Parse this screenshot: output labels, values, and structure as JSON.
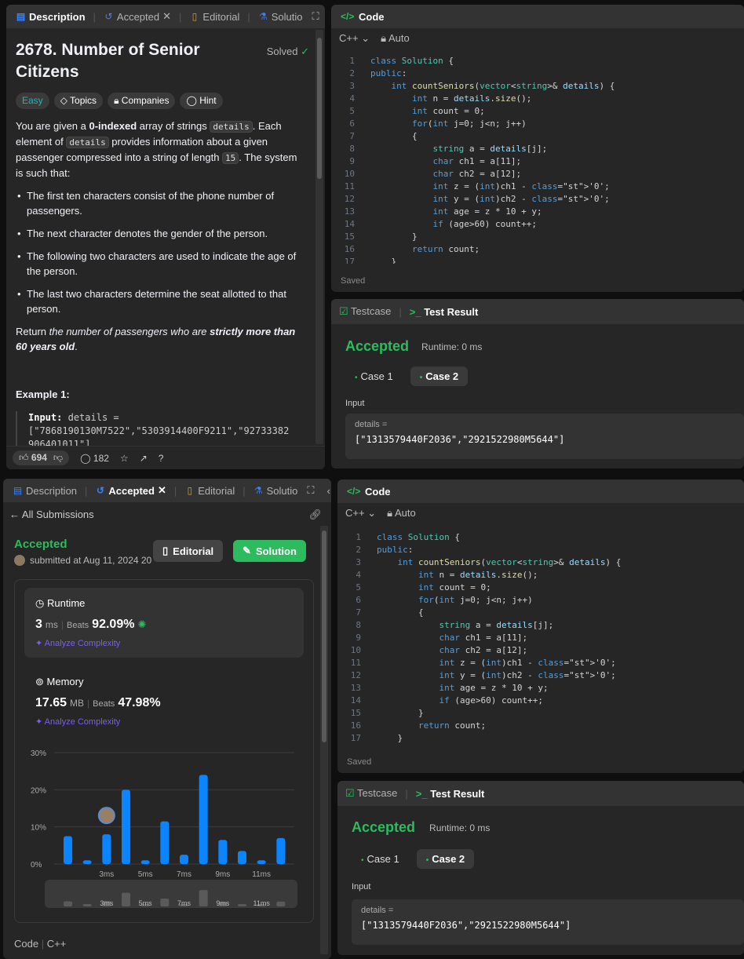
{
  "top_left": {
    "tabs": {
      "description": "Description",
      "accepted": "Accepted",
      "editorial": "Editorial",
      "solutions": "Solutio"
    },
    "problem_title": "2678. Number of Senior Citizens",
    "solved": "Solved",
    "chips": {
      "easy": "Easy",
      "topics": "Topics",
      "companies": "Companies",
      "hint": "Hint"
    },
    "p1a": "You are given a ",
    "p1b": "0-indexed",
    "p1c": " array of strings ",
    "p1d": "details",
    "p1e": ". Each element of ",
    "p1f": "details",
    "p1g": " provides information about a given passenger compressed into a string of length ",
    "p1h": "15",
    "p1i": ". The system is such that:",
    "bullets": [
      "The first ten characters consist of the phone number of passengers.",
      "The next character denotes the gender of the person.",
      "The following two characters are used to indicate the age of the person.",
      "The last two characters determine the seat allotted to that person."
    ],
    "return_a": "Return ",
    "return_b": "the number of passengers who are ",
    "return_c": "strictly more than 60 years old",
    "return_d": ".",
    "example_title": "Example 1:",
    "example_input_label": "Input:",
    "example_input_l1": "details =",
    "example_input_l2": "[\"7868190130M7522\",\"5303914400F9211\",\"92733382",
    "example_input_l3": "906401011\"]",
    "likes": "694",
    "comments": "182"
  },
  "code": {
    "title": "Code",
    "lang": "C++",
    "mode": "Auto",
    "saved": "Saved",
    "lines": [
      "class Solution {",
      "public:",
      "    int countSeniors(vector<string>& details) {",
      "        int n = details.size();",
      "        int count = 0;",
      "        for(int j=0; j<n; j++)",
      "        {",
      "            string a = details[j];",
      "            char ch1 = a[11];",
      "            char ch2 = a[12];",
      "            int z = (int)ch1 - '0';",
      "            int y = (int)ch2 - '0';",
      "            int age = z * 10 + y;",
      "            if (age>60) count++;",
      "        }",
      "        return count;",
      "    }"
    ],
    "line_numbers": [
      "1",
      "2",
      "3",
      "4",
      "5",
      "6",
      "7",
      "8",
      "9",
      "10",
      "11",
      "12",
      "13",
      "14",
      "15",
      "16",
      "17"
    ]
  },
  "test": {
    "testcase_tab": "Testcase",
    "result_tab": "Test Result",
    "status": "Accepted",
    "runtime": "Runtime: 0 ms",
    "case1": "Case 1",
    "case2": "Case 2",
    "input_label": "Input",
    "var_label": "details =",
    "var_value": "[\"1313579440F2036\",\"2921522980M5644\"]"
  },
  "submission": {
    "tabs": {
      "description": "Description",
      "accepted": "Accepted",
      "editorial": "Editorial",
      "solutions": "Solutio"
    },
    "back": "All Submissions",
    "status": "Accepted",
    "submitted": "submitted at Aug 11, 2024 20",
    "editorial_btn": "Editorial",
    "solution_btn": "Solution",
    "runtime_label": "Runtime",
    "runtime_value": "3",
    "runtime_unit": "ms",
    "beats_label": "Beats",
    "runtime_beats": "92.09%",
    "analyze": "Analyze Complexity",
    "memory_label": "Memory",
    "memory_value": "17.65",
    "memory_unit": "MB",
    "memory_beats": "47.98%",
    "footer_code": "Code",
    "footer_lang": "C++"
  },
  "chart_data": {
    "type": "bar",
    "title": "",
    "ylabel": "",
    "xlabel": "",
    "y_ticks": [
      "30%",
      "20%",
      "10%",
      "0%"
    ],
    "ylim": [
      0,
      30
    ],
    "x_tick_labels": [
      "3ms",
      "5ms",
      "7ms",
      "9ms",
      "11ms"
    ],
    "values": [
      7.5,
      1,
      8,
      20,
      1,
      11.5,
      2.5,
      24,
      6.5,
      3.5,
      1,
      7
    ],
    "highlight_index": 2,
    "colors": {
      "bar": "#0a84ff",
      "grid": "#3e3e3e"
    }
  },
  "colors": {
    "accent_green": "#2cbb5d",
    "accent_blue": "#3b82f6",
    "easy": "#1cb8b8",
    "gold": "#d4a017"
  }
}
